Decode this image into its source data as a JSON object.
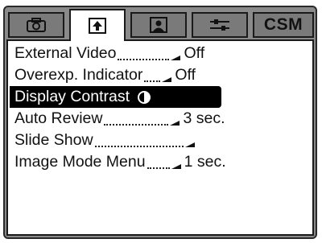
{
  "tabs": [
    {
      "icon": "camera-icon",
      "active": false
    },
    {
      "icon": "playback-menu-icon",
      "active": true
    },
    {
      "icon": "portrait-icon",
      "active": false
    },
    {
      "icon": "wrench-icon",
      "active": false
    },
    {
      "label": "CSM",
      "active": false
    }
  ],
  "menu": {
    "items": [
      {
        "label": "External Video",
        "value": "Off"
      },
      {
        "label": "Overexp. Indicator",
        "value": "Off"
      },
      {
        "label": "Display Contrast",
        "value": "",
        "selected": true,
        "icon": "contrast-icon"
      },
      {
        "label": "Auto Review",
        "value": "3 sec."
      },
      {
        "label": "Slide Show",
        "value": ""
      },
      {
        "label": "Image Mode Menu",
        "value": "1 sec."
      }
    ]
  }
}
